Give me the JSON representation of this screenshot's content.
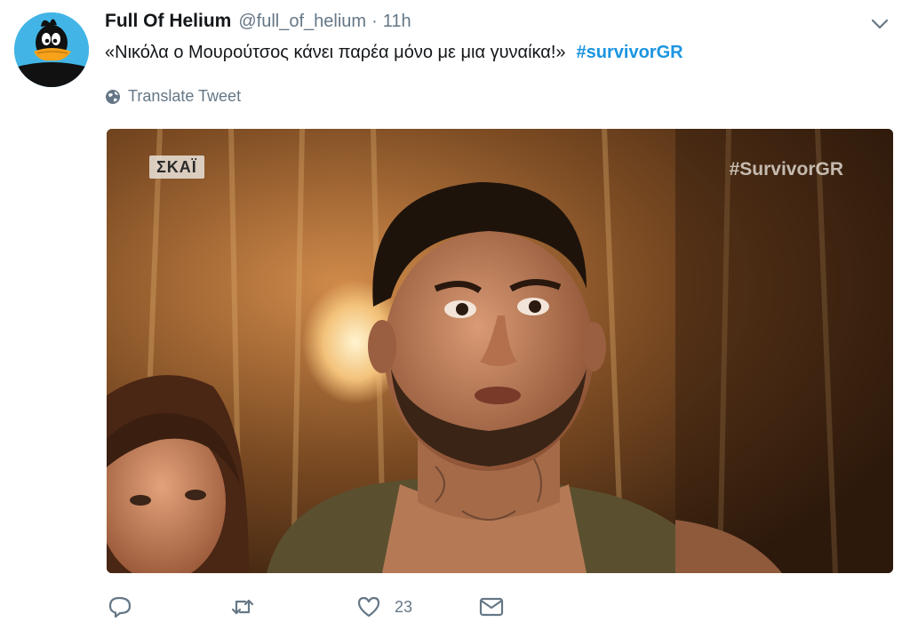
{
  "user": {
    "display_name": "Full Of Helium",
    "handle": "@full_of_helium",
    "separator": "·",
    "time": "11h",
    "avatar_icon": "daffy-duck-avatar"
  },
  "tweet": {
    "text": "«Νικόλα ο Μουρούτσος κάνει παρέα μόνο με μια γυναίκα!»",
    "hashtag": "#survivorGR",
    "translate_label": "Translate Tweet"
  },
  "media": {
    "channel_logo": "ΣΚΑΪ",
    "watermark": "#SurvivorGR"
  },
  "actions": {
    "like_count": "23"
  },
  "colors": {
    "link": "#1b95e0",
    "muted": "#657786",
    "text": "#14171a"
  }
}
